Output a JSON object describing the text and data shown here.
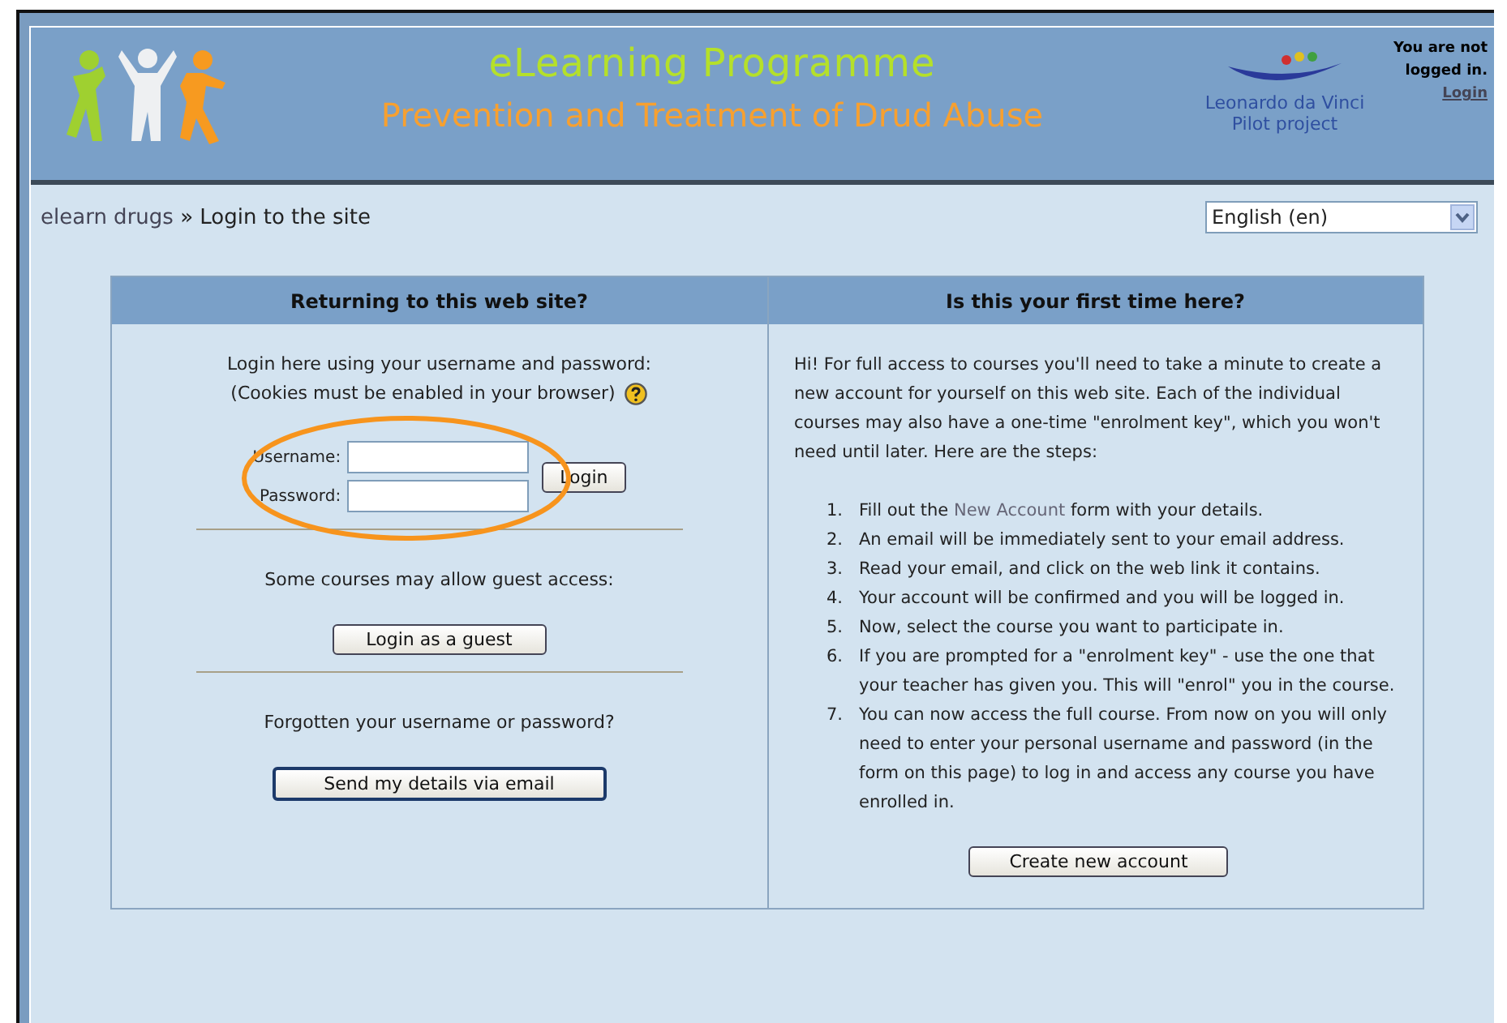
{
  "header": {
    "title": "eLearning Programme",
    "subtitle": "Prevention and Treatment of Drud Abuse",
    "partner_lines": [
      "Leonardo da Vinci",
      "Pilot project"
    ],
    "login_info": {
      "text_lines": [
        "You are not",
        "logged in."
      ],
      "link": "Login"
    }
  },
  "breadcrumb": {
    "home": "elearn drugs",
    "separator": "»",
    "current": "Login to the site"
  },
  "language_select": {
    "value": "English (en)"
  },
  "login_panel": {
    "heading": "Returning to this web site?",
    "intro_lines": [
      "Login here using your username and password:",
      "(Cookies must be enabled in your browser)"
    ],
    "fields": [
      {
        "label": "Username:"
      },
      {
        "label": "Password:"
      }
    ],
    "login_button": "Login",
    "highlighted": true,
    "guest_text": "Some courses may allow guest access:",
    "guest_button": "Login as a guest",
    "forgot_text": "Forgotten your username or password?",
    "forgot_button": "Send my details via email"
  },
  "signup_panel": {
    "heading": "Is this your first time here?",
    "intro": "Hi! For full access to courses you'll need to take a minute to create a new account for yourself on this web site. Each of the individual courses may also have a one-time \"enrolment key\", which you won't need until later. Here are the steps:",
    "steps": [
      {
        "number": "1.",
        "before": "Fill out the ",
        "link": "New Account",
        "after": " form with your details."
      },
      {
        "number": "2.",
        "before": "An email will be immediately sent to your email address."
      },
      {
        "number": "3.",
        "before": "Read your email, and click on the web link it contains."
      },
      {
        "number": "4.",
        "before": "Your account will be confirmed and you will be logged in."
      },
      {
        "number": "5.",
        "before": "Now, select the course you want to participate in."
      },
      {
        "number": "6.",
        "before": "If you are prompted for a \"enrolment key\" - use the one that your teacher has given you. This will \"enrol\" you in the course."
      },
      {
        "number": "7.",
        "before": "You can now access the full course. From now on you will only need to enter your personal username and password (in the form on this page) to log in and access any course you have enrolled in."
      }
    ],
    "button": "Create new account"
  }
}
